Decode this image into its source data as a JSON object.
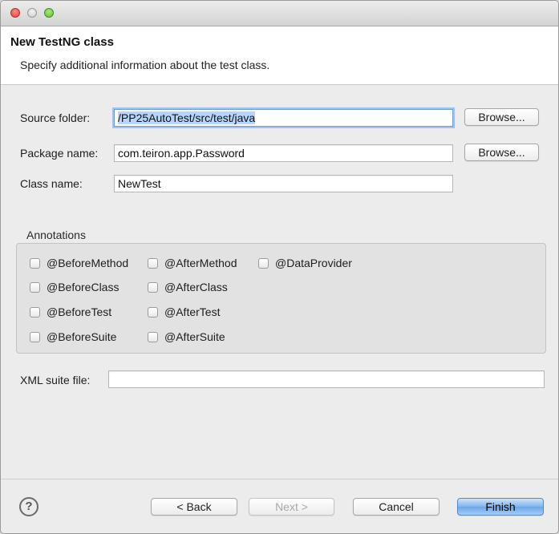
{
  "window": {
    "title": "",
    "heading": "New TestNG class",
    "description": "Specify additional information about the test class."
  },
  "form": {
    "source_folder": {
      "label": "Source folder:",
      "value": "/PP25AutoTest/src/test/java",
      "browse_label": "Browse..."
    },
    "package_name": {
      "label": "Package name:",
      "value": "com.teiron.app.Password",
      "browse_label": "Browse..."
    },
    "class_name": {
      "label": "Class name:",
      "value": "NewTest"
    },
    "xml_suite_file": {
      "label": "XML suite file:",
      "value": ""
    }
  },
  "annotations": {
    "label": "Annotations",
    "items": [
      {
        "label": "@BeforeMethod",
        "checked": false
      },
      {
        "label": "@AfterMethod",
        "checked": false
      },
      {
        "label": "@DataProvider",
        "checked": false
      },
      {
        "label": "@BeforeClass",
        "checked": false
      },
      {
        "label": "@AfterClass",
        "checked": false
      },
      {
        "label": "@BeforeTest",
        "checked": false
      },
      {
        "label": "@AfterTest",
        "checked": false
      },
      {
        "label": "@BeforeSuite",
        "checked": false
      },
      {
        "label": "@AfterSuite",
        "checked": false
      }
    ]
  },
  "footer": {
    "help_symbol": "?",
    "back_label": "< Back",
    "next_label": "Next >",
    "cancel_label": "Cancel",
    "finish_label": "Finish"
  },
  "colors": {
    "primary_button": "#7fb4ee",
    "selection": "#b6d5fc",
    "focus_ring": "#9fc2ef"
  }
}
